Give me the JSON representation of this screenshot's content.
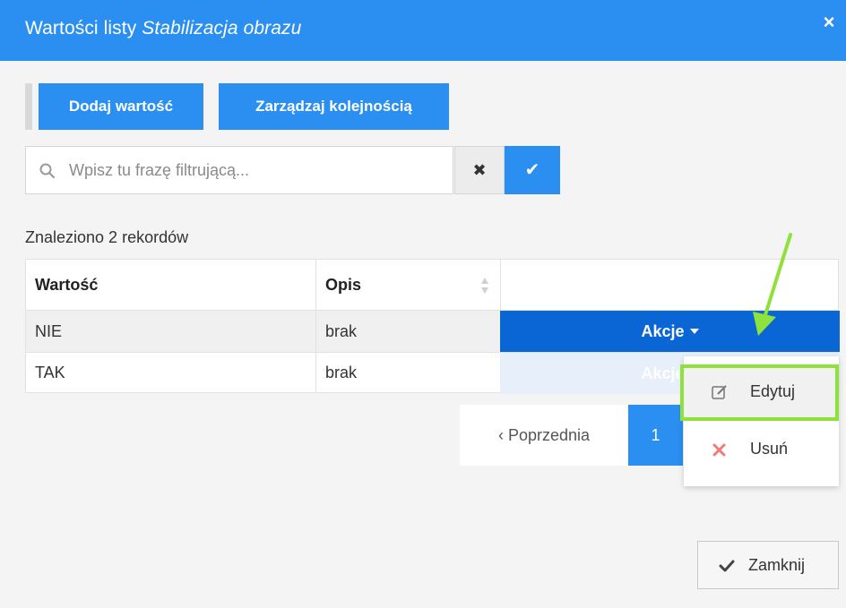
{
  "dialog": {
    "title_prefix": "Wartości listy",
    "title_italic": "Stabilizacja obrazu",
    "close_glyph": "×"
  },
  "toolbar": {
    "add_label": "Dodaj wartość",
    "order_label": "Zarządzaj kolejnością"
  },
  "search": {
    "placeholder": "Wpisz tu frazę filtrującą...",
    "value": "",
    "clear_glyph": "✖",
    "confirm_glyph": "✔"
  },
  "results": {
    "found_text": "Znaleziono 2 rekordów"
  },
  "table": {
    "columns": [
      "Wartość",
      "Opis",
      ""
    ],
    "rows": [
      {
        "value": "NIE",
        "desc": "brak",
        "action": "Akcje"
      },
      {
        "value": "TAK",
        "desc": "brak",
        "action": "Akcje"
      }
    ]
  },
  "pagination": {
    "prev_label": "‹ Poprzednia",
    "current_page": "1"
  },
  "actions_menu": {
    "items": [
      {
        "label": "Edytuj",
        "icon": "edit-icon"
      },
      {
        "label": "Usuń",
        "icon": "delete-icon"
      }
    ]
  },
  "footer": {
    "close_label": "Zamknij"
  },
  "colors": {
    "primary": "#2a8ff0",
    "active_action": "#0a66d4",
    "highlight": "#8fe23b",
    "delete": "#f07b7b"
  }
}
